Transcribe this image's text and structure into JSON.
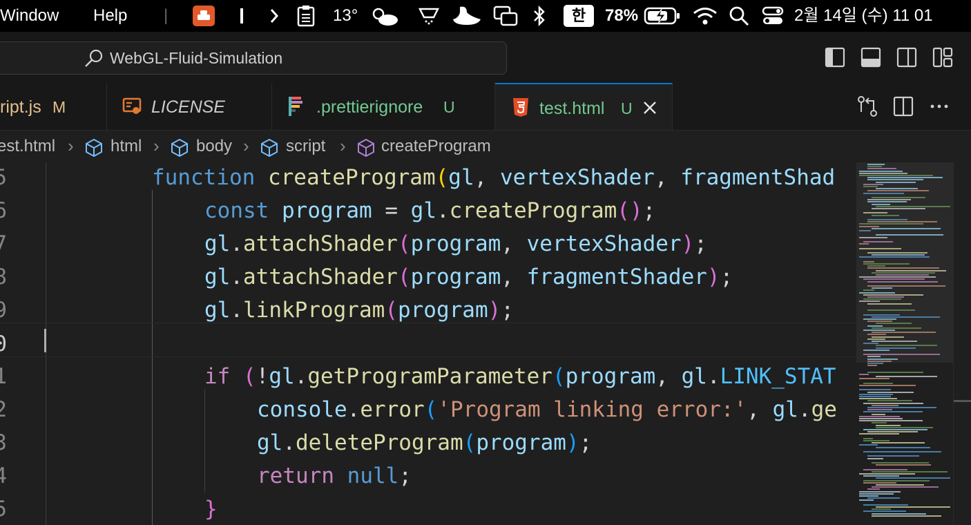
{
  "menubar": {
    "window": "Window",
    "help": "Help",
    "temperature": "13°",
    "ime": "한",
    "battery": "78%",
    "datetime": "2월 14일 (수) 11 01"
  },
  "titlebar": {
    "search_label": "WebGL-Fluid-Simulation"
  },
  "tabs": [
    {
      "label": "ript.js",
      "badge": "M",
      "color": "#e2c08d"
    },
    {
      "label": "LICENSE",
      "badge": "",
      "color": "#cccccc"
    },
    {
      "label": ".prettierignore",
      "badge": "U",
      "color": "#73c991"
    },
    {
      "label": "test.html",
      "badge": "U",
      "color": "#73c991"
    }
  ],
  "breadcrumb": {
    "file": "est.html",
    "items": [
      "html",
      "body",
      "script",
      "createProgram"
    ]
  },
  "editor": {
    "line_numbers": [
      "5",
      "6",
      "7",
      "8",
      "9",
      "0",
      "1",
      "2",
      "3",
      "4",
      "5"
    ],
    "current_line_index": 5
  },
  "colors": {
    "keyword": "#569cd6",
    "control": "#c586c0",
    "function": "#dcdcaa",
    "variable": "#9cdcfe",
    "constant": "#4fc1ff",
    "string": "#ce9178",
    "accent": "#0078d4"
  }
}
